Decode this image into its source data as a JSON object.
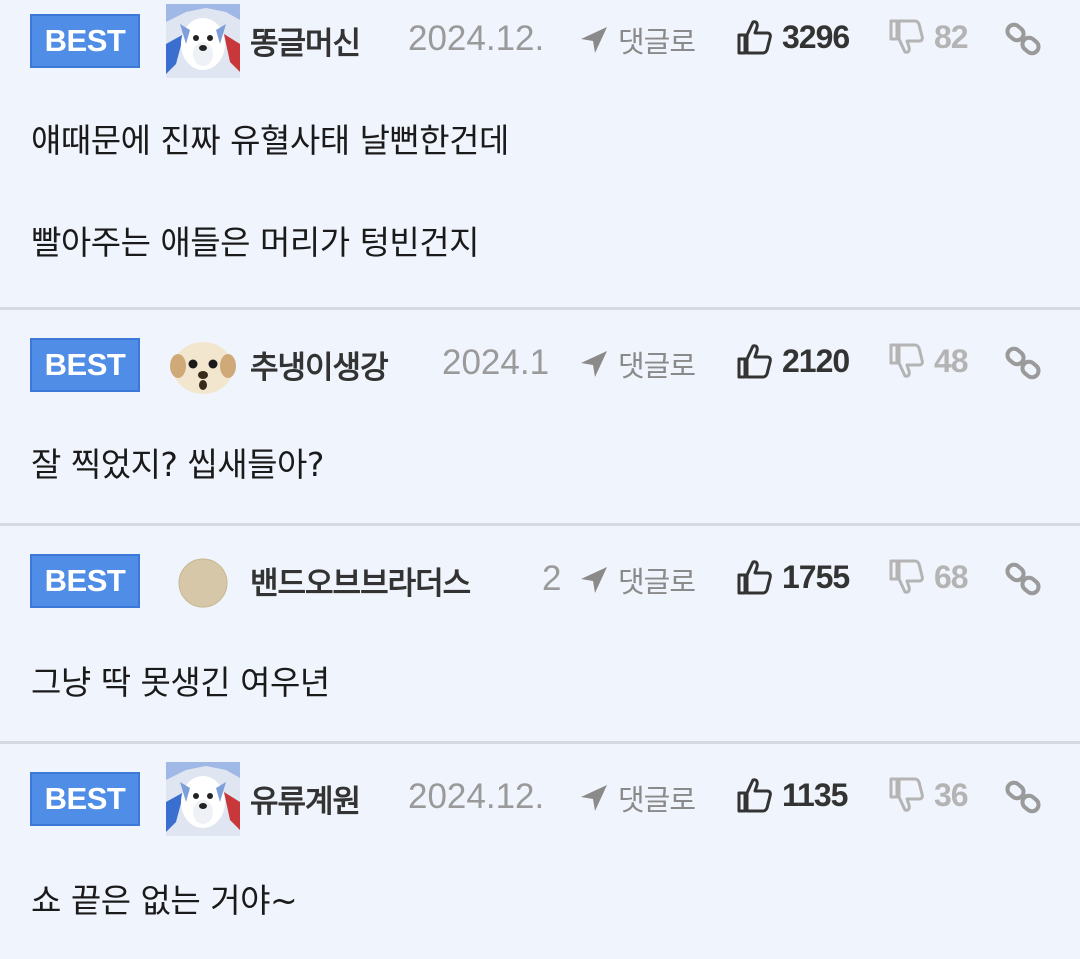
{
  "comments": [
    {
      "badge": "BEST",
      "avatar": "dog-avatar-icon",
      "nickname": "똥글머신",
      "date": "2024.12.",
      "reply_label": "댓글로",
      "upvotes": "3296",
      "downvotes": "82",
      "lines": [
        "얘때문에 진짜 유혈사태 날뻔한건데",
        "빨아주는 애들은 머리가 텅빈건지"
      ]
    },
    {
      "badge": "BEST",
      "avatar": "puppy-face-avatar-icon",
      "nickname": "추냉이생강",
      "date": "2024.1",
      "reply_label": "댓글로",
      "upvotes": "2120",
      "downvotes": "48",
      "lines": [
        "잘 찍었지? 씹새들아?"
      ]
    },
    {
      "badge": "BEST",
      "avatar": "beige-circle-avatar-icon",
      "nickname": "밴드오브브라더스",
      "date": "2",
      "reply_label": "댓글로",
      "upvotes": "1755",
      "downvotes": "68",
      "lines": [
        "그냥 딱 못생긴 여우년"
      ]
    },
    {
      "badge": "BEST",
      "avatar": "dog-avatar-icon",
      "nickname": "유류계원",
      "date": "2024.12.",
      "reply_label": "댓글로",
      "upvotes": "1135",
      "downvotes": "36",
      "lines": [
        "쇼 끝은 없는 거야~"
      ]
    }
  ],
  "colors": {
    "background": "#f0f4fc",
    "badge": "#4f8de6",
    "divider": "#d6dae0",
    "text": "#1a1a1a",
    "muted": "#9a9a9a"
  }
}
